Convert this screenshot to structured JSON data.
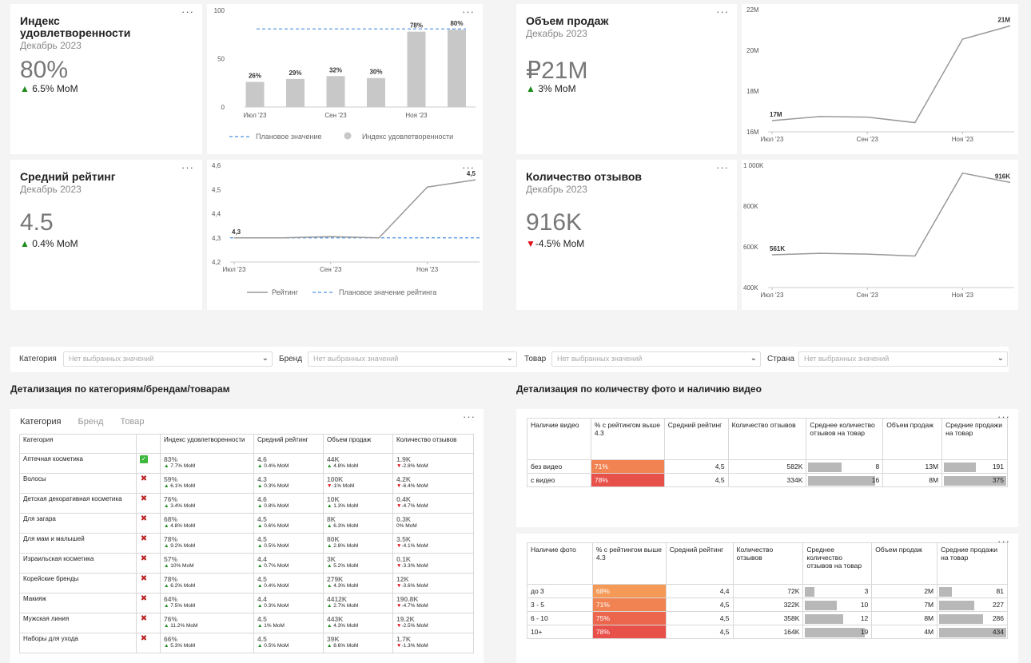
{
  "kpis": {
    "satisfaction": {
      "title": "Индекс удовлетворенности",
      "period": "Декабрь 2023",
      "value": "80%",
      "delta": "6.5% MoM",
      "dir": "up"
    },
    "rating": {
      "title": "Средний рейтинг",
      "period": "Декабрь 2023",
      "value": "4.5",
      "delta": "0.4% MoM",
      "dir": "up"
    },
    "sales": {
      "title": "Объем продаж",
      "period": "Декабрь 2023",
      "value": "₽21M",
      "delta": "3% MoM",
      "dir": "up"
    },
    "reviews": {
      "title": "Количество отзывов",
      "period": "Декабрь 2023",
      "value": "916K",
      "delta": "-4.5% MoM",
      "dir": "down"
    }
  },
  "menu_icon": "more-dots-icon",
  "colors": {
    "bar": "#c8c8c8",
    "line": "#999999",
    "plan": "#4a90e2",
    "pct_low": "#f5a050",
    "pct_high": "#e8504a",
    "up": "#1a8a1a",
    "down": "#e0101a"
  },
  "chart_data": [
    {
      "type": "bar",
      "id": "satisfaction",
      "categories": [
        "Июл '23",
        "Авг '23",
        "Сен '23",
        "Окт '23",
        "Ноя '23",
        "Дек '23"
      ],
      "tick_labels": [
        "Июл '23",
        "Сен '23",
        "Ноя '23"
      ],
      "values": [
        26,
        29,
        32,
        30,
        78,
        80
      ],
      "data_labels": [
        "26%",
        "29%",
        "32%",
        "30%",
        "78%",
        "80%"
      ],
      "plan": 80,
      "ylim": [
        0,
        100
      ],
      "yticks": [
        "0",
        "50",
        "100"
      ],
      "legend": [
        "Плановое значение",
        "Индекс удовлетворенности"
      ]
    },
    {
      "type": "line",
      "id": "rating",
      "categories": [
        "Июл '23",
        "Авг '23",
        "Сен '23",
        "Окт '23",
        "Ноя '23",
        "Дек '23"
      ],
      "tick_labels": [
        "Июл '23",
        "Сен '23",
        "Ноя '23"
      ],
      "values": [
        4.3,
        4.3,
        4.305,
        4.3,
        4.51,
        4.54
      ],
      "plan": 4.3,
      "first_label": "4,3",
      "last_label": "4,5",
      "ylim": [
        4.2,
        4.6
      ],
      "yticks": [
        "4,2",
        "4,3",
        "4,4",
        "4,5",
        "4,6"
      ],
      "legend": [
        "Рейтинг",
        "Плановое значение рейтинга"
      ]
    },
    {
      "type": "line",
      "id": "sales",
      "categories": [
        "Июл '23",
        "Авг '23",
        "Сен '23",
        "Окт '23",
        "Ноя '23",
        "Дек '23"
      ],
      "tick_labels": [
        "Июл '23",
        "Сен '23",
        "Ноя '23"
      ],
      "values": [
        16.55,
        16.75,
        16.72,
        16.45,
        20.55,
        21.2
      ],
      "first_label": "17M",
      "last_label": "21M",
      "ylim": [
        16,
        22
      ],
      "yticks": [
        "16M",
        "18M",
        "20M",
        "22M"
      ]
    },
    {
      "type": "line",
      "id": "reviews",
      "categories": [
        "Июл '23",
        "Авг '23",
        "Сен '23",
        "Окт '23",
        "Ноя '23",
        "Дек '23"
      ],
      "tick_labels": [
        "Июл '23",
        "Сен '23",
        "Ноя '23"
      ],
      "values": [
        561,
        568,
        564,
        555,
        962,
        916
      ],
      "first_label": "561K",
      "last_label": "916K",
      "ylim": [
        400,
        1000
      ],
      "yticks": [
        "400K",
        "600K",
        "800K",
        "1 000K"
      ]
    }
  ],
  "filters": [
    {
      "label": "Категория",
      "placeholder": "Нет выбранных значений"
    },
    {
      "label": "Бренд",
      "placeholder": "Нет выбранных значений"
    },
    {
      "label": "Товар",
      "placeholder": "Нет выбранных значений"
    },
    {
      "label": "Страна",
      "placeholder": "Нет выбранных значений"
    }
  ],
  "section_left": "Детализация по категориям/брендам/товарам",
  "section_right": "Детализация по количеству фото и наличию видео",
  "tabs": [
    "Категория",
    "Бренд",
    "Товар"
  ],
  "cat_table": {
    "headers": [
      "Категория",
      "",
      "Индекс удовлетворенности",
      "Средний рейтинг",
      "Объем продаж",
      "Количество отзывов"
    ],
    "rows": [
      {
        "name": "Аптечная косметика",
        "ok": true,
        "idx": "83%",
        "idx_d": "▲ 7.7% MoM",
        "rt": "4.6",
        "rt_d": "▲ 0.4% MoM",
        "sl": "44K",
        "sl_d": "▲ 4.8% MoM",
        "rv": "1.9K",
        "rv_d": "▼-2.8% MoM"
      },
      {
        "name": "Волосы",
        "ok": false,
        "idx": "59%",
        "idx_d": "▲ 6.1% MoM",
        "rt": "4.3",
        "rt_d": "▲ 0.3% MoM",
        "sl": "100K",
        "sl_d": "▼-1% MoM",
        "rv": "4.2K",
        "rv_d": "▼-6.4% MoM"
      },
      {
        "name": "Детская декоративная косметика",
        "ok": false,
        "idx": "76%",
        "idx_d": "▲ 3.4% MoM",
        "rt": "4.6",
        "rt_d": "▲ 0.8% MoM",
        "sl": "10K",
        "sl_d": "▲ 1.3% MoM",
        "rv": "0.4K",
        "rv_d": "▼-4.7% MoM"
      },
      {
        "name": "Для загара",
        "ok": false,
        "idx": "68%",
        "idx_d": "▲ 4.8% MoM",
        "rt": "4.5",
        "rt_d": "▲ 0.6% MoM",
        "sl": "8K",
        "sl_d": "▲ 6.3% MoM",
        "rv": "0.3K",
        "rv_d": "0% MoM"
      },
      {
        "name": "Для мам и малышей",
        "ok": false,
        "idx": "78%",
        "idx_d": "▲ 9.2% MoM",
        "rt": "4.5",
        "rt_d": "▲ 0.5% MoM",
        "sl": "80K",
        "sl_d": "▲ 2.8% MoM",
        "rv": "3.5K",
        "rv_d": "▼-4.1% MoM"
      },
      {
        "name": "Израильская косметика",
        "ok": false,
        "idx": "57%",
        "idx_d": "▲ 10% MoM",
        "rt": "4.4",
        "rt_d": "▲ 0.7% MoM",
        "sl": "3K",
        "sl_d": "▲ 5.2% MoM",
        "rv": "0.1K",
        "rv_d": "▼-3.3% MoM"
      },
      {
        "name": "Корейские бренды",
        "ok": false,
        "idx": "78%",
        "idx_d": "▲ 6.2% MoM",
        "rt": "4.5",
        "rt_d": "▲ 0.4% MoM",
        "sl": "279K",
        "sl_d": "▲ 4.3% MoM",
        "rv": "12K",
        "rv_d": "▼-3.6% MoM"
      },
      {
        "name": "Макияж",
        "ok": false,
        "idx": "64%",
        "idx_d": "▲ 7.5% MoM",
        "rt": "4.4",
        "rt_d": "▲ 0.3% MoM",
        "sl": "4412K",
        "sl_d": "▲ 2.7% MoM",
        "rv": "190.8K",
        "rv_d": "▼-4.7% MoM"
      },
      {
        "name": "Мужская линия",
        "ok": false,
        "idx": "76%",
        "idx_d": "▲ 11.2% MoM",
        "rt": "4.5",
        "rt_d": "▲ 1% MoM",
        "sl": "443K",
        "sl_d": "▲ 4.3% MoM",
        "rv": "19.2K",
        "rv_d": "▼-2.5% MoM"
      },
      {
        "name": "Наборы для ухода",
        "ok": false,
        "idx": "66%",
        "idx_d": "▲ 5.3% MoM",
        "rt": "4.5",
        "rt_d": "▲ 0.5% MoM",
        "sl": "39K",
        "sl_d": "▲ 8.6% MoM",
        "rv": "1.7K",
        "rv_d": "▼-1.3% MoM"
      }
    ]
  },
  "video_table": {
    "headers": [
      "Наличие видео",
      "% с рейтингом выше 4.3",
      "Средний рейтинг",
      "Количество отзывов",
      "Среднее количество отзывов на товар",
      "Объем продаж",
      "Средние продажи на товар"
    ],
    "rows": [
      {
        "name": "без видео",
        "pct": "71%",
        "pct_v": 71,
        "rt": "4,5",
        "rv": "582K",
        "avg": "8",
        "avg_v": 8,
        "sl": "13M",
        "avs": "191",
        "avs_v": 191
      },
      {
        "name": "с видео",
        "pct": "78%",
        "pct_v": 78,
        "rt": "4,5",
        "rv": "334K",
        "avg": "16",
        "avg_v": 16,
        "sl": "8M",
        "avs": "375",
        "avs_v": 375
      }
    ]
  },
  "photo_table": {
    "headers": [
      "Наличие фото",
      "% с рейтингом выше 4.3",
      "Средний рейтинг",
      "Количество отзывов",
      "Среднее количество отзывов на товар",
      "Объем продаж",
      "Средние продажи на товар"
    ],
    "rows": [
      {
        "name": "до 3",
        "pct": "68%",
        "pct_v": 68,
        "rt": "4,4",
        "rv": "72K",
        "avg": "3",
        "avg_v": 3,
        "sl": "2M",
        "avs": "81",
        "avs_v": 81
      },
      {
        "name": "3 - 5",
        "pct": "71%",
        "pct_v": 71,
        "rt": "4,5",
        "rv": "322K",
        "avg": "10",
        "avg_v": 10,
        "sl": "7M",
        "avs": "227",
        "avs_v": 227
      },
      {
        "name": "6 - 10",
        "pct": "75%",
        "pct_v": 75,
        "rt": "4,5",
        "rv": "358K",
        "avg": "12",
        "avg_v": 12,
        "sl": "8M",
        "avs": "286",
        "avs_v": 286
      },
      {
        "name": "10+",
        "pct": "78%",
        "pct_v": 78,
        "rt": "4,5",
        "rv": "164K",
        "avg": "19",
        "avg_v": 19,
        "sl": "4M",
        "avs": "434",
        "avs_v": 434
      }
    ]
  }
}
